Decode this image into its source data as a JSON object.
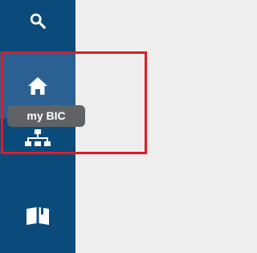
{
  "colors": {
    "sidebar_bg": "#0b4b7b",
    "active_item_bg": "#2a6192",
    "content_bg": "#eeeeee",
    "tooltip_bg": "#5f6366",
    "highlight_border": "#e01b24",
    "icon_color": "#ffffff"
  },
  "sidebar": {
    "items": [
      {
        "id": "search",
        "icon": "search-icon",
        "active": false
      },
      {
        "id": "home",
        "icon": "home-icon",
        "active": true
      },
      {
        "id": "org",
        "icon": "org-chart-icon",
        "active": false
      },
      {
        "id": "library",
        "icon": "book-icon",
        "active": false
      }
    ]
  },
  "tooltip": {
    "label": "my BIC"
  }
}
